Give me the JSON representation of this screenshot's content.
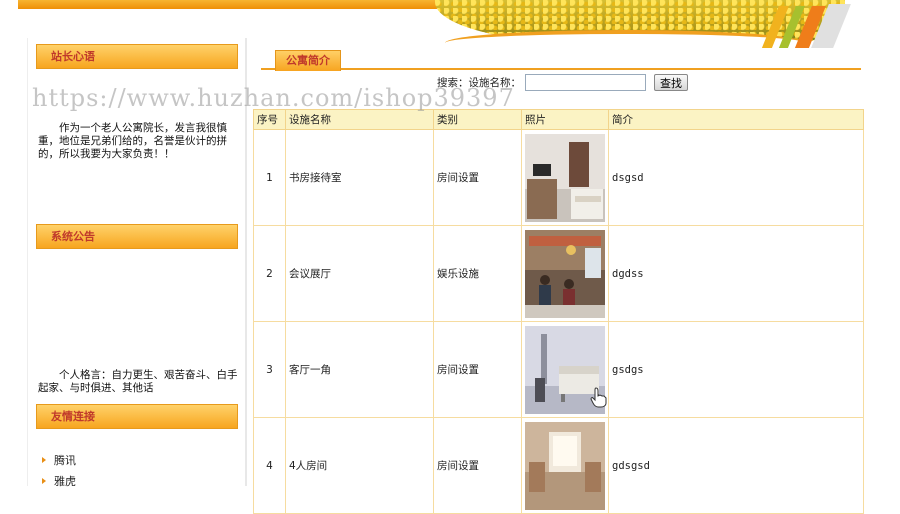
{
  "sidebar": {
    "head1": "站长心语",
    "text1": "作为一个老人公寓院长，发言我很慎重，地位是兄弟们给的，名誉是伙计的拼的，所以我要为大家负责！！",
    "head2": "系统公告",
    "text2": "个人格言：自力更生、艰苦奋斗、白手起家、与时俱进、其他话",
    "head3": "友情连接",
    "links": [
      "腾讯",
      "雅虎"
    ]
  },
  "main": {
    "tab_label": "公寓简介",
    "search_label": "搜索：设施名称：",
    "search_value": "",
    "search_button": "查找"
  },
  "table": {
    "headers": [
      "序号",
      "设施名称",
      "类别",
      "照片",
      "简介"
    ],
    "rows": [
      {
        "no": "1",
        "name": "书房接待室",
        "category": "房间设置",
        "intro": "dsgsd"
      },
      {
        "no": "2",
        "name": "会议展厅",
        "category": "娱乐设施",
        "intro": "dgdss"
      },
      {
        "no": "3",
        "name": "客厅一角",
        "category": "房间设置",
        "intro": "gsdgs"
      },
      {
        "no": "4",
        "name": "4人房间",
        "category": "房间设置",
        "intro": "gdsgsd"
      }
    ]
  },
  "watermark": "https://www.huzhan.com/ishop39397"
}
